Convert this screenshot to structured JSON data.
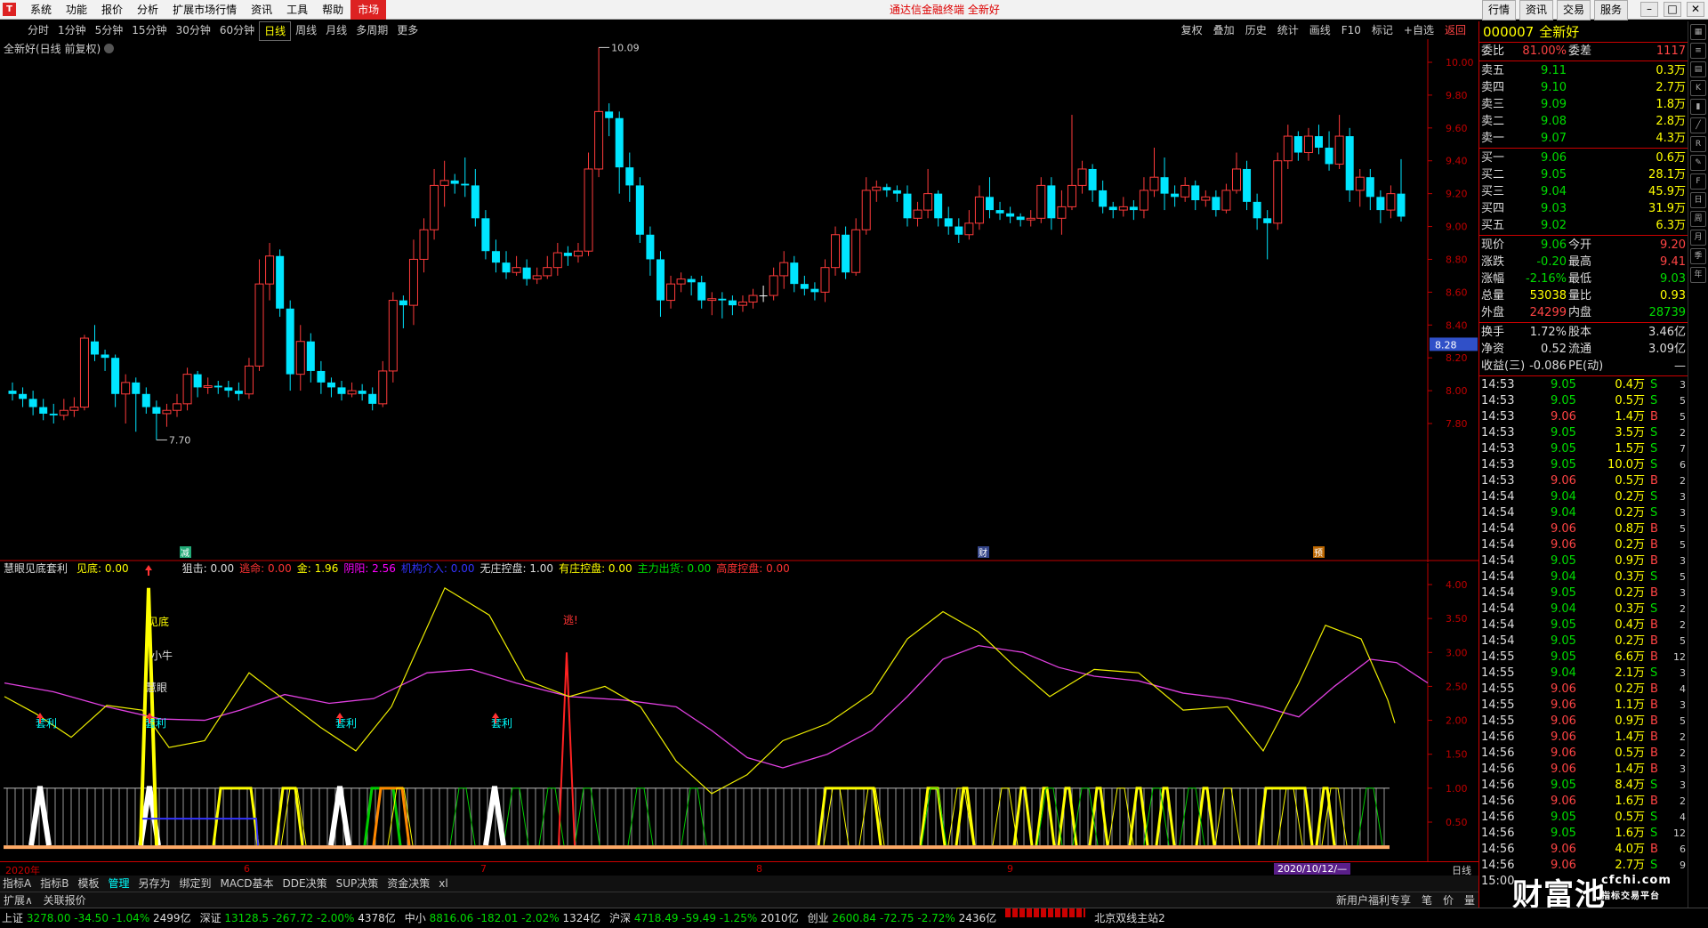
{
  "app": {
    "title": "通达信金融终端 全新好",
    "menu": [
      "系统",
      "功能",
      "报价",
      "分析",
      "扩展市场行情",
      "资讯",
      "工具",
      "帮助",
      "市场"
    ],
    "right_buttons": [
      "行情",
      "资讯",
      "交易",
      "服务"
    ]
  },
  "toolbar": {
    "periods": [
      "分时",
      "1分钟",
      "5分钟",
      "15分钟",
      "30分钟",
      "60分钟",
      "日线",
      "周线",
      "月线",
      "多周期",
      "更多"
    ],
    "selected_period": "日线",
    "tools": [
      "复权",
      "叠加",
      "历史",
      "统计",
      "画线",
      "F10",
      "标记",
      "+自选",
      "返回"
    ]
  },
  "main_chart": {
    "stock_label": "全新好(日线 前复权)",
    "price_axis": [
      "10.00",
      "9.80",
      "9.60",
      "9.40",
      "9.20",
      "9.00",
      "8.80",
      "8.60",
      "8.40",
      "8.20",
      "8.00",
      "7.80"
    ],
    "current_price_tag": "8.28",
    "high_marker": "10.09",
    "low_marker": "7.70",
    "event_marks": [
      "减",
      "财",
      "预"
    ],
    "candles": [
      [
        8.0,
        7.98,
        8.05,
        7.94
      ],
      [
        7.98,
        7.95,
        8.02,
        7.9
      ],
      [
        7.95,
        7.9,
        8.0,
        7.85
      ],
      [
        7.9,
        7.86,
        7.95,
        7.82
      ],
      [
        7.86,
        7.85,
        7.92,
        7.8
      ],
      [
        7.85,
        7.88,
        7.95,
        7.82
      ],
      [
        7.88,
        7.9,
        7.96,
        7.84
      ],
      [
        7.9,
        8.32,
        8.34,
        7.88
      ],
      [
        8.3,
        8.22,
        8.4,
        8.18
      ],
      [
        8.22,
        8.2,
        8.25,
        8.12
      ],
      [
        8.2,
        7.98,
        8.22,
        7.9
      ],
      [
        7.98,
        8.05,
        8.1,
        7.8
      ],
      [
        8.05,
        7.98,
        8.08,
        7.75
      ],
      [
        7.98,
        7.9,
        8.02,
        7.86
      ],
      [
        7.9,
        7.86,
        7.94,
        7.7
      ],
      [
        7.86,
        7.88,
        7.92,
        7.78
      ],
      [
        7.88,
        7.92,
        7.98,
        7.84
      ],
      [
        7.92,
        8.1,
        8.14,
        7.88
      ],
      [
        8.1,
        8.02,
        8.12,
        7.96
      ],
      [
        8.02,
        8.03,
        8.08,
        7.98
      ],
      [
        8.03,
        8.02,
        8.06,
        7.98
      ],
      [
        8.02,
        8.0,
        8.06,
        7.96
      ],
      [
        8.0,
        7.98,
        8.05,
        7.94
      ],
      [
        7.98,
        8.15,
        8.2,
        7.95
      ],
      [
        8.15,
        8.65,
        8.8,
        8.12
      ],
      [
        8.65,
        8.82,
        8.9,
        8.55
      ],
      [
        8.82,
        8.5,
        8.86,
        8.45
      ],
      [
        8.5,
        8.1,
        8.55,
        8.0
      ],
      [
        8.1,
        8.3,
        8.4,
        8.0
      ],
      [
        8.3,
        8.12,
        8.35,
        8.05
      ],
      [
        8.12,
        8.05,
        8.18,
        7.98
      ],
      [
        8.05,
        8.02,
        8.08,
        7.96
      ],
      [
        8.02,
        7.98,
        8.06,
        7.94
      ],
      [
        7.98,
        8.0,
        8.05,
        7.96
      ],
      [
        8.0,
        7.98,
        8.04,
        7.94
      ],
      [
        7.98,
        7.92,
        8.02,
        7.88
      ],
      [
        7.92,
        8.12,
        8.18,
        7.9
      ],
      [
        8.12,
        8.55,
        8.6,
        8.05
      ],
      [
        8.55,
        8.52,
        8.58,
        8.38
      ],
      [
        8.52,
        8.8,
        8.92,
        8.4
      ],
      [
        8.8,
        8.98,
        9.05,
        8.72
      ],
      [
        8.98,
        9.25,
        9.35,
        8.92
      ],
      [
        9.25,
        9.28,
        9.4,
        9.12
      ],
      [
        9.28,
        9.26,
        9.32,
        9.2
      ],
      [
        9.26,
        9.25,
        9.42,
        9.18
      ],
      [
        9.25,
        9.05,
        9.35,
        9.0
      ],
      [
        9.05,
        8.85,
        9.1,
        8.8
      ],
      [
        8.85,
        8.78,
        8.92,
        8.72
      ],
      [
        8.78,
        8.72,
        8.85,
        8.68
      ],
      [
        8.72,
        8.75,
        8.82,
        8.7
      ],
      [
        8.75,
        8.68,
        8.8,
        8.64
      ],
      [
        8.68,
        8.7,
        8.75,
        8.65
      ],
      [
        8.7,
        8.75,
        8.82,
        8.68
      ],
      [
        8.75,
        8.84,
        8.9,
        8.7
      ],
      [
        8.84,
        8.82,
        8.88,
        8.76
      ],
      [
        8.82,
        8.85,
        8.9,
        8.78
      ],
      [
        8.85,
        9.35,
        9.45,
        8.82
      ],
      [
        9.35,
        9.7,
        10.09,
        9.3
      ],
      [
        9.7,
        9.66,
        9.75,
        9.55
      ],
      [
        9.66,
        9.36,
        9.7,
        9.2
      ],
      [
        9.36,
        9.25,
        9.45,
        9.15
      ],
      [
        9.25,
        8.95,
        9.3,
        8.9
      ],
      [
        8.95,
        8.8,
        9.0,
        8.7
      ],
      [
        8.8,
        8.55,
        8.85,
        8.45
      ],
      [
        8.55,
        8.65,
        8.7,
        8.5
      ],
      [
        8.65,
        8.68,
        8.72,
        8.6
      ],
      [
        8.68,
        8.66,
        8.7,
        8.58
      ],
      [
        8.66,
        8.55,
        8.7,
        8.5
      ],
      [
        8.55,
        8.56,
        8.6,
        8.46
      ],
      [
        8.56,
        8.55,
        8.6,
        8.44
      ],
      [
        8.55,
        8.52,
        8.58,
        8.46
      ],
      [
        8.52,
        8.54,
        8.58,
        8.48
      ],
      [
        8.54,
        8.58,
        8.62,
        8.5
      ],
      [
        8.58,
        8.58,
        8.64,
        8.54
      ],
      [
        8.58,
        8.7,
        8.75,
        8.55
      ],
      [
        8.7,
        8.78,
        8.85,
        8.62
      ],
      [
        8.78,
        8.65,
        8.82,
        8.6
      ],
      [
        8.65,
        8.62,
        8.7,
        8.58
      ],
      [
        8.62,
        8.6,
        8.66,
        8.55
      ],
      [
        8.6,
        8.75,
        8.8,
        8.54
      ],
      [
        8.75,
        8.95,
        9.0,
        8.7
      ],
      [
        8.95,
        8.72,
        9.0,
        8.68
      ],
      [
        8.72,
        8.98,
        9.05,
        8.7
      ],
      [
        8.98,
        9.22,
        9.3,
        8.95
      ],
      [
        9.22,
        9.24,
        9.28,
        9.15
      ],
      [
        9.24,
        9.22,
        9.26,
        9.18
      ],
      [
        9.22,
        9.2,
        9.25,
        9.15
      ],
      [
        9.2,
        9.05,
        9.25,
        9.0
      ],
      [
        9.05,
        9.1,
        9.15,
        9.0
      ],
      [
        9.1,
        9.2,
        9.35,
        9.05
      ],
      [
        9.2,
        9.05,
        9.22,
        9.0
      ],
      [
        9.05,
        9.0,
        9.12,
        8.95
      ],
      [
        9.0,
        8.95,
        9.05,
        8.9
      ],
      [
        8.95,
        9.02,
        9.1,
        8.92
      ],
      [
        9.02,
        9.18,
        9.25,
        8.98
      ],
      [
        9.18,
        9.1,
        9.3,
        9.05
      ],
      [
        9.1,
        9.08,
        9.15,
        9.04
      ],
      [
        9.08,
        9.06,
        9.12,
        9.02
      ],
      [
        9.06,
        9.04,
        9.08,
        9.0
      ],
      [
        9.04,
        9.05,
        9.1,
        9.0
      ],
      [
        9.05,
        9.25,
        9.3,
        9.02
      ],
      [
        9.25,
        9.05,
        9.3,
        8.98
      ],
      [
        9.05,
        9.12,
        9.22,
        8.95
      ],
      [
        9.12,
        9.25,
        9.68,
        9.1
      ],
      [
        9.25,
        9.35,
        9.4,
        9.2
      ],
      [
        9.35,
        9.22,
        9.38,
        9.15
      ],
      [
        9.22,
        9.12,
        9.28,
        9.08
      ],
      [
        9.12,
        9.1,
        9.15,
        9.05
      ],
      [
        9.1,
        9.12,
        9.18,
        9.06
      ],
      [
        9.12,
        9.1,
        9.16,
        9.04
      ],
      [
        9.1,
        9.22,
        9.3,
        9.05
      ],
      [
        9.22,
        9.3,
        9.48,
        9.18
      ],
      [
        9.3,
        9.2,
        9.42,
        9.1
      ],
      [
        9.2,
        9.18,
        9.25,
        9.12
      ],
      [
        9.18,
        9.25,
        9.3,
        9.15
      ],
      [
        9.25,
        9.16,
        9.28,
        9.1
      ],
      [
        9.16,
        9.18,
        9.22,
        9.12
      ],
      [
        9.18,
        9.1,
        9.22,
        9.06
      ],
      [
        9.1,
        9.22,
        9.26,
        9.08
      ],
      [
        9.22,
        9.35,
        9.45,
        9.2
      ],
      [
        9.35,
        9.15,
        9.4,
        9.1
      ],
      [
        9.15,
        9.05,
        9.2,
        8.98
      ],
      [
        9.05,
        9.02,
        9.1,
        8.8
      ],
      [
        9.02,
        9.4,
        9.45,
        8.98
      ],
      [
        9.4,
        9.55,
        9.62,
        9.35
      ],
      [
        9.55,
        9.45,
        9.58,
        9.4
      ],
      [
        9.45,
        9.55,
        9.6,
        9.4
      ],
      [
        9.55,
        9.48,
        9.62,
        9.44
      ],
      [
        9.48,
        9.38,
        9.58,
        9.34
      ],
      [
        9.38,
        9.55,
        9.68,
        9.35
      ],
      [
        9.55,
        9.22,
        9.6,
        9.15
      ],
      [
        9.22,
        9.3,
        9.35,
        9.12
      ],
      [
        9.3,
        9.18,
        9.35,
        9.1
      ],
      [
        9.18,
        9.1,
        9.22,
        9.02
      ],
      [
        9.1,
        9.2,
        9.25,
        9.05
      ],
      [
        9.2,
        9.06,
        9.41,
        9.03
      ]
    ]
  },
  "indicator": {
    "legend": [
      {
        "label": "慧眼见底套利",
        "color": "#ddd"
      },
      {
        "label": "见底: 0.00",
        "color": "#ff0"
      },
      {
        "label": "狙击: 0.00",
        "color": "#ddd"
      },
      {
        "label": "逃命: 0.00",
        "color": "#f33"
      },
      {
        "label": "金: 1.96",
        "color": "#ff0"
      },
      {
        "label": "阴阳: 2.56",
        "color": "#f0f"
      },
      {
        "label": "机构介入: 0.00",
        "color": "#33f"
      },
      {
        "label": "无庄控盘: 1.00",
        "color": "#ddd"
      },
      {
        "label": "有庄控盘: 0.00",
        "color": "#ff0"
      },
      {
        "label": "主力出货: 0.00",
        "color": "#0d0"
      },
      {
        "label": "高度控盘: 0.00",
        "color": "#f33"
      }
    ],
    "axis": [
      "4.00",
      "3.50",
      "3.00",
      "2.50",
      "2.00",
      "1.50",
      "1.00",
      "0.50"
    ],
    "labels": {
      "jiandi": "见底",
      "xiaoniu": "小牛",
      "huiyan": "慧眼",
      "taoli": "套利",
      "tao": "逃!"
    },
    "date_tag": "2020/10/12/—",
    "year_tag": "2020年",
    "month_ticks": [
      "6",
      "7",
      "8",
      "9"
    ],
    "period_tag": "日线"
  },
  "bottom_tabs": [
    "指标A",
    "指标B",
    "模板",
    "管理",
    "另存为",
    "绑定到",
    "MACD基本",
    "DDE决策",
    "SUP决策",
    "资金决策",
    "xl"
  ],
  "bottom_tabs2": {
    "left": [
      "扩展∧",
      "关联报价"
    ],
    "right": [
      "新用户福利专享",
      "笔",
      "价",
      "量"
    ]
  },
  "status_bar": [
    {
      "name": "上证",
      "val": "3278.00",
      "chg": "-34.50",
      "pct": "-1.04%",
      "amt": "2499亿"
    },
    {
      "name": "深证",
      "val": "13128.5",
      "chg": "-267.72",
      "pct": "-2.00%",
      "amt": "4378亿"
    },
    {
      "name": "中小",
      "val": "8816.06",
      "chg": "-182.01",
      "pct": "-2.02%",
      "amt": "1324亿"
    },
    {
      "name": "沪深",
      "val": "4718.49",
      "chg": "-59.49",
      "pct": "-1.25%",
      "amt": "2010亿"
    },
    {
      "name": "创业",
      "val": "2600.84",
      "chg": "-72.75",
      "pct": "-2.72%",
      "amt": "2436亿"
    }
  ],
  "status_site": "北京双线主站2",
  "quote": {
    "code": "000007",
    "name": "全新好",
    "wb": {
      "label": "委比",
      "val": "81.00%",
      "label2": "委差",
      "val2": "1117"
    },
    "asks": [
      {
        "label": "卖五",
        "price": "9.11",
        "vol": "0.3万"
      },
      {
        "label": "卖四",
        "price": "9.10",
        "vol": "2.7万"
      },
      {
        "label": "卖三",
        "price": "9.09",
        "vol": "1.8万"
      },
      {
        "label": "卖二",
        "price": "9.08",
        "vol": "2.8万"
      },
      {
        "label": "卖一",
        "price": "9.07",
        "vol": "4.3万"
      }
    ],
    "bids": [
      {
        "label": "买一",
        "price": "9.06",
        "vol": "0.6万"
      },
      {
        "label": "买二",
        "price": "9.05",
        "vol": "28.1万"
      },
      {
        "label": "买三",
        "price": "9.04",
        "vol": "45.9万"
      },
      {
        "label": "买四",
        "price": "9.03",
        "vol": "31.9万"
      },
      {
        "label": "买五",
        "price": "9.02",
        "vol": "6.3万"
      }
    ],
    "stats1": [
      {
        "a": "现价",
        "b": "9.06",
        "bc": "cg",
        "c": "今开",
        "d": "9.20",
        "dc": "cr"
      },
      {
        "a": "涨跌",
        "b": "-0.20",
        "bc": "cg",
        "c": "最高",
        "d": "9.41",
        "dc": "cr"
      },
      {
        "a": "涨幅",
        "b": "-2.16%",
        "bc": "cg",
        "c": "最低",
        "d": "9.03",
        "dc": "cg"
      },
      {
        "a": "总量",
        "b": "53038",
        "bc": "cy",
        "c": "量比",
        "d": "0.93",
        "dc": "cy"
      },
      {
        "a": "外盘",
        "b": "24299",
        "bc": "cr",
        "c": "内盘",
        "d": "28739",
        "dc": "cg"
      }
    ],
    "stats2": [
      {
        "a": "换手",
        "b": "1.72%",
        "bc": "cw",
        "c": "股本",
        "d": "3.46亿",
        "dc": "cw"
      },
      {
        "a": "净资",
        "b": "0.52",
        "bc": "cw",
        "c": "流通",
        "d": "3.09亿",
        "dc": "cw"
      },
      {
        "a": "收益(三)",
        "b": "-0.086",
        "bc": "cw",
        "c": "PE(动)",
        "d": "—",
        "dc": "cw"
      }
    ],
    "ticks": [
      [
        "14:53",
        "9.05",
        "0.4万",
        "S",
        "3"
      ],
      [
        "14:53",
        "9.05",
        "0.5万",
        "S",
        "5"
      ],
      [
        "14:53",
        "9.06",
        "1.4万",
        "B",
        "5"
      ],
      [
        "14:53",
        "9.05",
        "3.5万",
        "S",
        "2"
      ],
      [
        "14:53",
        "9.05",
        "1.5万",
        "S",
        "7"
      ],
      [
        "14:53",
        "9.05",
        "10.0万",
        "S",
        "6"
      ],
      [
        "14:53",
        "9.06",
        "0.5万",
        "B",
        "2"
      ],
      [
        "14:54",
        "9.04",
        "0.2万",
        "S",
        "3"
      ],
      [
        "14:54",
        "9.04",
        "0.2万",
        "S",
        "3"
      ],
      [
        "14:54",
        "9.06",
        "0.8万",
        "B",
        "5"
      ],
      [
        "14:54",
        "9.06",
        "0.2万",
        "B",
        "5"
      ],
      [
        "14:54",
        "9.05",
        "0.9万",
        "B",
        "3"
      ],
      [
        "14:54",
        "9.04",
        "0.3万",
        "S",
        "5"
      ],
      [
        "14:54",
        "9.05",
        "0.2万",
        "B",
        "3"
      ],
      [
        "14:54",
        "9.04",
        "0.3万",
        "S",
        "2"
      ],
      [
        "14:54",
        "9.05",
        "0.4万",
        "B",
        "2"
      ],
      [
        "14:54",
        "9.05",
        "0.2万",
        "B",
        "5"
      ],
      [
        "14:55",
        "9.05",
        "6.6万",
        "B",
        "12"
      ],
      [
        "14:55",
        "9.04",
        "2.1万",
        "S",
        "3"
      ],
      [
        "14:55",
        "9.06",
        "0.2万",
        "B",
        "4"
      ],
      [
        "14:55",
        "9.06",
        "1.1万",
        "B",
        "3"
      ],
      [
        "14:55",
        "9.06",
        "0.9万",
        "B",
        "5"
      ],
      [
        "14:56",
        "9.06",
        "1.4万",
        "B",
        "2"
      ],
      [
        "14:56",
        "9.06",
        "0.5万",
        "B",
        "2"
      ],
      [
        "14:56",
        "9.06",
        "1.4万",
        "B",
        "3"
      ],
      [
        "14:56",
        "9.05",
        "8.4万",
        "S",
        "3"
      ],
      [
        "14:56",
        "9.06",
        "1.6万",
        "B",
        "2"
      ],
      [
        "14:56",
        "9.05",
        "0.5万",
        "S",
        "4"
      ],
      [
        "14:56",
        "9.05",
        "1.6万",
        "S",
        "12"
      ],
      [
        "14:56",
        "9.06",
        "4.0万",
        "B",
        "6"
      ],
      [
        "14:56",
        "9.06",
        "2.7万",
        "S",
        "9"
      ],
      [
        "15:00",
        "",
        "",
        "",
        ""
      ]
    ]
  },
  "watermark": {
    "big": "财富池",
    "site": "cfchi.com",
    "sub": "指标交易平台"
  },
  "colors": {
    "up": "#ff3b3b",
    "down": "#00e5ff",
    "axis": "#c00000"
  },
  "sidebar_icons": [
    "chart-icon",
    "list-icon",
    "grid-icon",
    "k-icon",
    "bar-icon",
    "line-icon",
    "rsi-icon",
    "pen-icon",
    "f-icon",
    "day-icon",
    "week-icon",
    "month-icon",
    "season-icon",
    "year-icon"
  ]
}
